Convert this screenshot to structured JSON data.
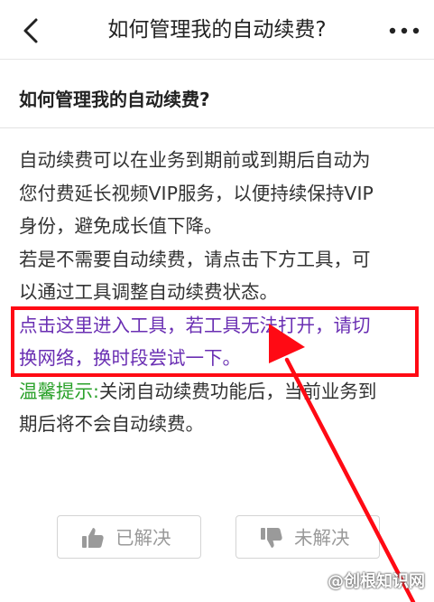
{
  "nav": {
    "title": "如何管理我的自动续费?",
    "back_icon": "chevron-left-icon",
    "more_icon": "more-dots-icon"
  },
  "question": {
    "title": "如何管理我的自动续费?"
  },
  "answer": {
    "paragraph1": [
      "自动续费可以在业务到期前或到期后自动为",
      "您付费延长视频VIP服务，以便持续保持VIP",
      "身份，避免成长值下降。"
    ],
    "paragraph2": [
      "若是不需要自动续费，请点击下方工具，可",
      "以通过工具调整自动续费状态。"
    ],
    "link_lines": [
      "点击这里进入工具，若工具无法打开，请切",
      "换网络，换时段尝试一下。"
    ],
    "tip_label": "温馨提示:",
    "tip_line1_rest": "关闭自动续费功能后，当前业务到",
    "tip_line2": "期后将不会自动续费。"
  },
  "feedback": {
    "solved_label": "已解决",
    "unsolved_label": "未解决"
  },
  "watermark": "@创根知识网",
  "colors": {
    "link": "#6a2fb3",
    "tip": "#2aa12a",
    "annotation": "#ff0a14"
  }
}
